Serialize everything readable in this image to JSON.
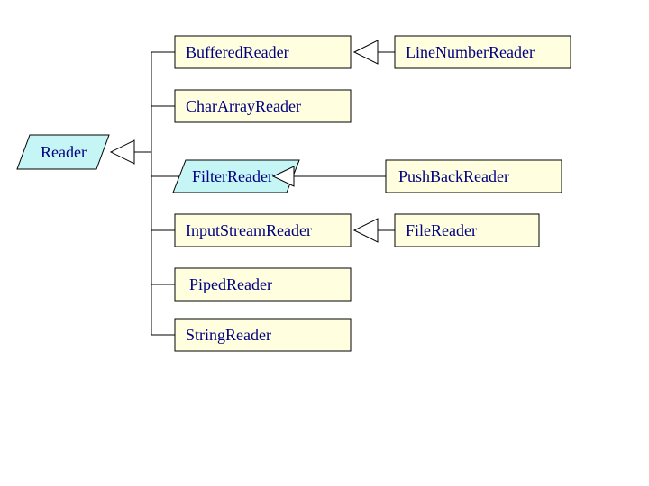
{
  "diagram": {
    "root": "Reader",
    "children": {
      "bufferedReader": "BufferedReader",
      "charArrayReader": "CharArrayReader",
      "filterReader": "FilterReader",
      "inputStreamReader": "InputStreamReader",
      "pipedReader": "PipedReader",
      "stringReader": "StringReader"
    },
    "grandchildren": {
      "lineNumberReader": "LineNumberReader",
      "pushBackReader": "PushBackReader",
      "fileReader": "FileReader"
    },
    "abstractClasses": [
      "Reader",
      "FilterReader"
    ],
    "relations": [
      {
        "child": "BufferedReader",
        "parent": "Reader"
      },
      {
        "child": "CharArrayReader",
        "parent": "Reader"
      },
      {
        "child": "FilterReader",
        "parent": "Reader"
      },
      {
        "child": "InputStreamReader",
        "parent": "Reader"
      },
      {
        "child": "PipedReader",
        "parent": "Reader"
      },
      {
        "child": "StringReader",
        "parent": "Reader"
      },
      {
        "child": "LineNumberReader",
        "parent": "BufferedReader"
      },
      {
        "child": "PushBackReader",
        "parent": "FilterReader"
      },
      {
        "child": "FileReader",
        "parent": "InputStreamReader"
      }
    ]
  }
}
